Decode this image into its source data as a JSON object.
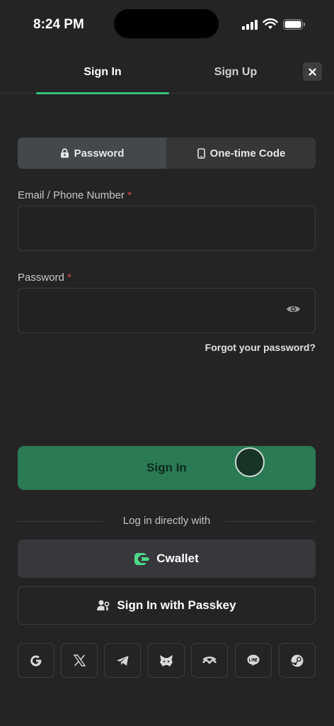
{
  "status": {
    "time": "8:24 PM"
  },
  "tabs": [
    {
      "label": "Sign In",
      "active": true
    },
    {
      "label": "Sign Up",
      "active": false
    }
  ],
  "close_icon": "close-icon",
  "method_toggle": {
    "password": {
      "label": "Password",
      "icon": "lock-icon",
      "selected": true
    },
    "otp": {
      "label": "One-time Code",
      "icon": "phone-icon",
      "selected": false
    }
  },
  "form": {
    "email_label": "Email / Phone Number",
    "email_value": "",
    "password_label": "Password",
    "password_value": "",
    "required_mark": "*",
    "forgot": "Forgot your password?"
  },
  "signin_button": "Sign In",
  "alt_login": {
    "divider": "Log in directly with",
    "cwallet": "Cwallet",
    "passkey": "Sign In with Passkey"
  },
  "socials": [
    "google-icon",
    "x-icon",
    "telegram-icon",
    "metamask-icon",
    "walletconnect-icon",
    "line-icon",
    "steam-icon"
  ],
  "colors": {
    "background": "#242424",
    "accent": "#2fc47a",
    "primary_button": "#2a7a54",
    "required": "#e5484d"
  }
}
